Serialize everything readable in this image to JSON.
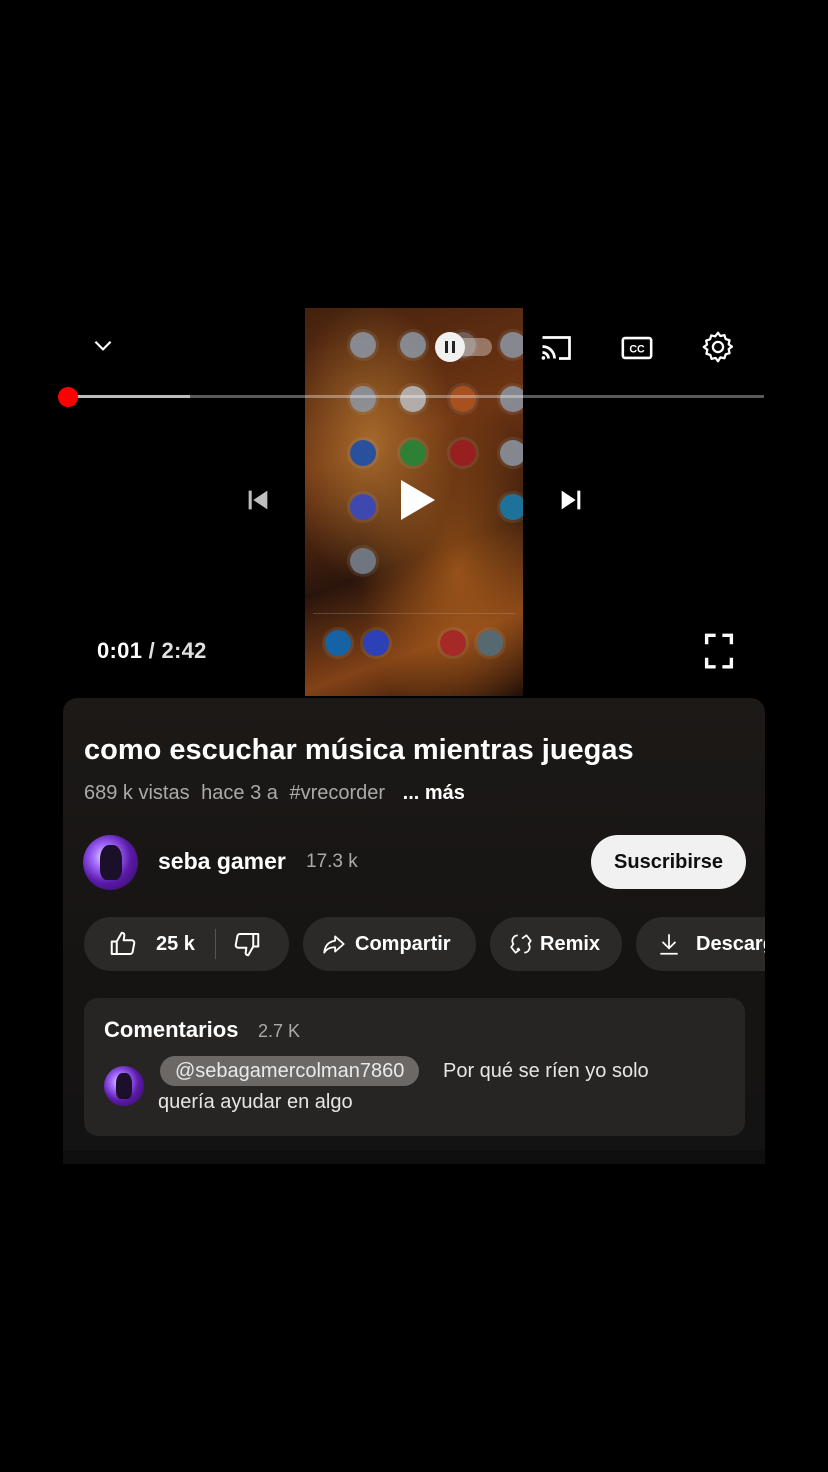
{
  "player": {
    "current_time": "0:01",
    "separator": " / ",
    "duration": "2:42",
    "progress_fraction": 0.006,
    "buffered_fraction": 0.18,
    "state": "paused",
    "autoplay": "on",
    "accent": "#ff0000",
    "icons": {
      "collapse": "chevron-down-icon",
      "autoplay": "autoplay-toggle-icon",
      "cast": "cast-icon",
      "captions": "closed-captions-icon",
      "settings": "gear-icon",
      "previous": "skip-previous-icon",
      "play": "play-icon",
      "next": "skip-next-icon",
      "fullscreen": "fullscreen-icon"
    }
  },
  "video": {
    "title": "como escuchar música mientras juegas",
    "views": "689 k vistas",
    "age": "hace 3 a",
    "hashtag": "#vrecorder",
    "more": "... más"
  },
  "channel": {
    "name": "seba gamer",
    "subscribers": "17.3 k",
    "subscribe_label": "Suscribirse"
  },
  "actions": {
    "likes": "25 k",
    "share": "Compartir",
    "remix": "Remix",
    "download": "Descargar"
  },
  "comments": {
    "title": "Comentarios",
    "count": "2.7 K",
    "top_comment": {
      "mention": "@sebagamercolman7860",
      "text_line1": "Por qué se ríen yo solo",
      "text_line2": "quería ayudar en algo"
    }
  }
}
